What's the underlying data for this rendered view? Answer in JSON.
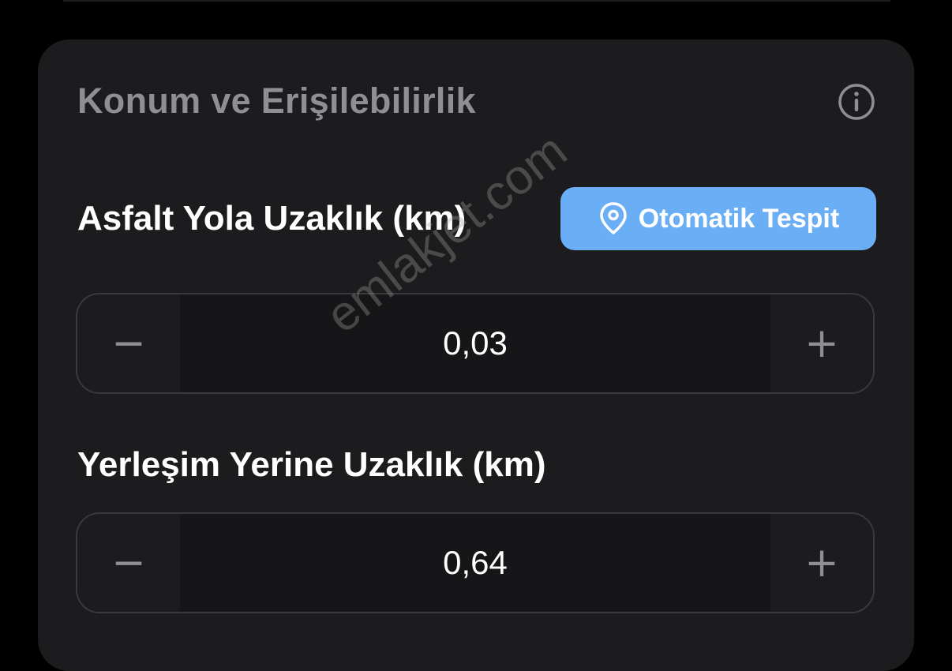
{
  "section": {
    "title": "Konum ve Erişilebilirlik",
    "info_icon": "info-circle-icon"
  },
  "fields": [
    {
      "label": "Asfalt Yola Uzaklık (km)",
      "value": "0,03",
      "minus_symbol": "−",
      "plus_symbol": "+"
    },
    {
      "label": "Yerleşim Yerine Uzaklık (km)",
      "value": "0,64",
      "minus_symbol": "−",
      "plus_symbol": "+"
    }
  ],
  "auto_detect": {
    "label": "Otomatik Tespit",
    "icon": "location-pin-icon"
  },
  "watermark": "emlakjet.com",
  "colors": {
    "background": "#000000",
    "card": "#1c1c1e",
    "accent": "#6aaef5",
    "muted_text": "#8e8e93",
    "text": "#ffffff"
  }
}
